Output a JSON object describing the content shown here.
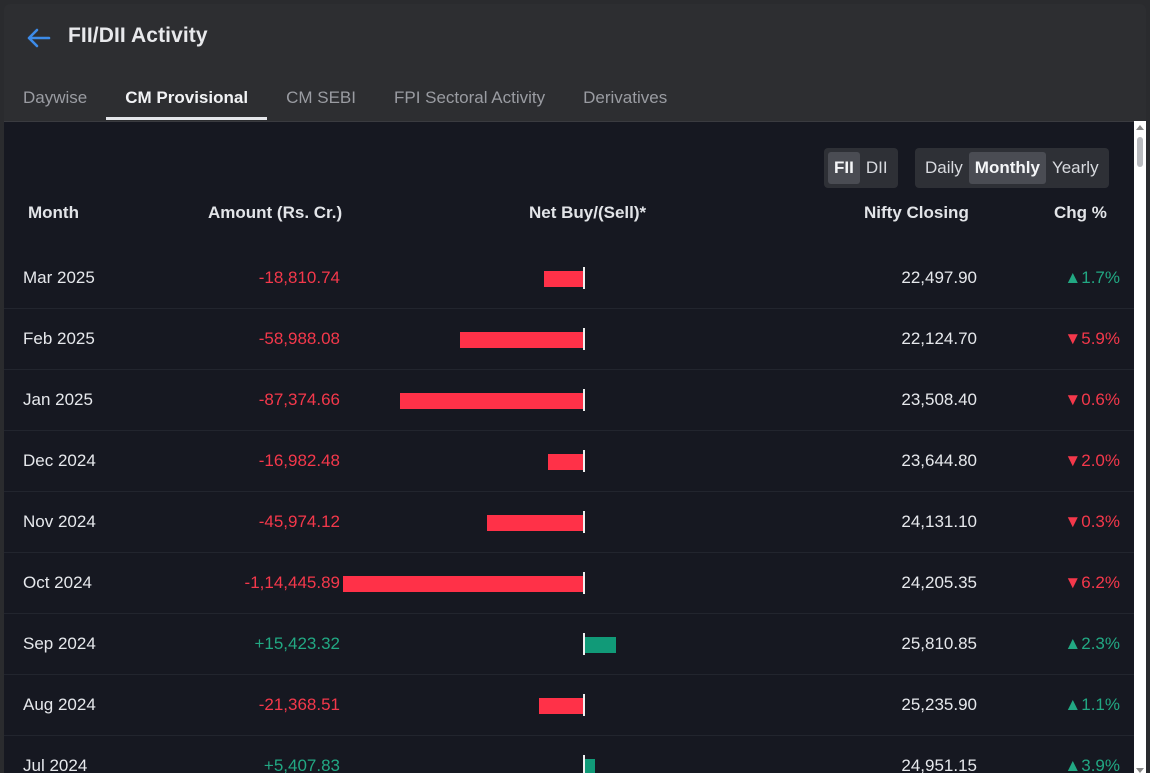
{
  "header": {
    "title": "FII/DII Activity",
    "back_icon": "arrow-left-icon"
  },
  "tabs": [
    {
      "label": "Daywise",
      "active": false
    },
    {
      "label": "CM Provisional",
      "active": true
    },
    {
      "label": "CM SEBI",
      "active": false
    },
    {
      "label": "FPI Sectoral Activity",
      "active": false
    },
    {
      "label": "Derivatives",
      "active": false
    }
  ],
  "investor_toggle": [
    {
      "label": "FII",
      "active": true
    },
    {
      "label": "DII",
      "active": false
    }
  ],
  "period_toggle": [
    {
      "label": "Daily",
      "active": false
    },
    {
      "label": "Monthly",
      "active": true
    },
    {
      "label": "Yearly",
      "active": false
    }
  ],
  "table": {
    "headers": {
      "month": "Month",
      "amount": "Amount (Rs. Cr.)",
      "net": "Net Buy/(Sell)*",
      "nifty": "Nifty Closing",
      "chg": "Chg %"
    },
    "rows": [
      {
        "month": "Mar 2025",
        "amount": "-18,810.74",
        "value": -18810.74,
        "nifty": "22,497.90",
        "chg": "▲1.7%",
        "chg_dir": "up"
      },
      {
        "month": "Feb 2025",
        "amount": "-58,988.08",
        "value": -58988.08,
        "nifty": "22,124.70",
        "chg": "▼5.9%",
        "chg_dir": "down"
      },
      {
        "month": "Jan 2025",
        "amount": "-87,374.66",
        "value": -87374.66,
        "nifty": "23,508.40",
        "chg": "▼0.6%",
        "chg_dir": "down"
      },
      {
        "month": "Dec 2024",
        "amount": "-16,982.48",
        "value": -16982.48,
        "nifty": "23,644.80",
        "chg": "▼2.0%",
        "chg_dir": "down"
      },
      {
        "month": "Nov 2024",
        "amount": "-45,974.12",
        "value": -45974.12,
        "nifty": "24,131.10",
        "chg": "▼0.3%",
        "chg_dir": "down"
      },
      {
        "month": "Oct 2024",
        "amount": "-1,14,445.89",
        "value": -114445.89,
        "nifty": "24,205.35",
        "chg": "▼6.2%",
        "chg_dir": "down"
      },
      {
        "month": "Sep 2024",
        "amount": "+15,423.32",
        "value": 15423.32,
        "nifty": "25,810.85",
        "chg": "▲2.3%",
        "chg_dir": "up"
      },
      {
        "month": "Aug 2024",
        "amount": "-21,368.51",
        "value": -21368.51,
        "nifty": "25,235.90",
        "chg": "▲1.1%",
        "chg_dir": "up"
      },
      {
        "month": "Jul 2024",
        "amount": "+5,407.83",
        "value": 5407.83,
        "nifty": "24,951.15",
        "chg": "▲3.9%",
        "chg_dir": "up"
      }
    ]
  },
  "colors": {
    "negative": "#f4384b",
    "positive": "#22a883",
    "neg_bar": "#ff3148",
    "pos_bar": "#119a78",
    "background": "#161821",
    "accent": "#3d8be8"
  }
}
